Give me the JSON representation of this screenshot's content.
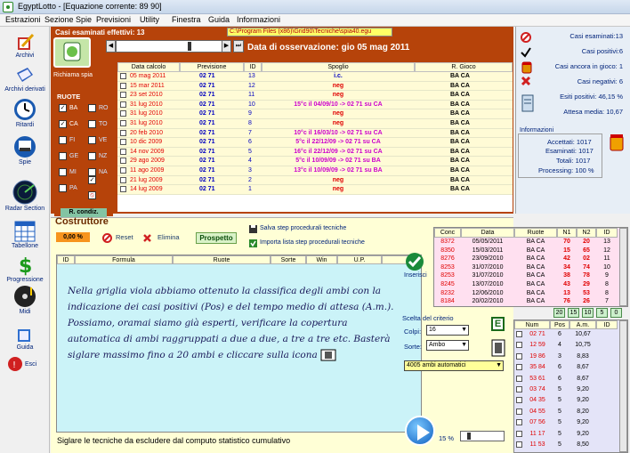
{
  "window": {
    "title": "EgyptLotto - [Equazione corrente: 89 90]"
  },
  "menu": [
    "Estrazioni",
    "Sezione Spie",
    "Previsioni",
    "Utility",
    "Finestra",
    "Guida",
    "Informazioni"
  ],
  "sidebar": [
    {
      "label": "Archivi",
      "icon": "book-pencil-icon"
    },
    {
      "label": "Archivi derivati",
      "icon": "book-icon"
    },
    {
      "label": "Ritardi",
      "icon": "clock-icon"
    },
    {
      "label": "Spie",
      "icon": "spy-icon"
    },
    {
      "label": "Radar Section",
      "icon": "radar-icon"
    },
    {
      "label": "Tabellone",
      "icon": "calendar-table-icon"
    },
    {
      "label": "Progressione",
      "icon": "dollar-icon"
    },
    {
      "label": "Midi",
      "icon": "music-icon"
    },
    {
      "label": "Guida",
      "icon": "guide-icon"
    },
    {
      "label": "Esci",
      "icon": "exit-icon"
    }
  ],
  "top": {
    "casi_label": "Casi esaminati effettivi: 13",
    "path": "C:\\Program Files (x86)\\Grid90\\Tecniche\\spia40.egu",
    "data_osservazione": "Data di osservazione:  gio 05 mag 2011",
    "richiama": "Richiama spia"
  },
  "grid1": {
    "headers": [
      "Data calcolo",
      "Previsione",
      "ID",
      "Spoglio",
      "R. Gioco"
    ],
    "rows": [
      {
        "date": "05 mag 2011",
        "prev": "02 71",
        "id": "13",
        "spoglio": "i.c.",
        "rg": "BA CA",
        "sclr": "#0000c0"
      },
      {
        "date": "15 mar 2011",
        "prev": "02 71",
        "id": "12",
        "spoglio": "neg",
        "rg": "BA CA",
        "sclr": "#e00000"
      },
      {
        "date": "23 set 2010",
        "prev": "02 71",
        "id": "11",
        "spoglio": "neg",
        "rg": "BA CA",
        "sclr": "#e00000"
      },
      {
        "date": "31 lug 2010",
        "prev": "02 71",
        "id": "10",
        "spoglio": "15°c il 04/09/10 -> 02 71 su CA",
        "rg": "BA CA",
        "sclr": "#cc00cc"
      },
      {
        "date": "31 lug 2010",
        "prev": "02 71",
        "id": "9",
        "spoglio": "neg",
        "rg": "BA CA",
        "sclr": "#e00000"
      },
      {
        "date": "31 lug 2010",
        "prev": "02 71",
        "id": "8",
        "spoglio": "neg",
        "rg": "BA CA",
        "sclr": "#e00000"
      },
      {
        "date": "20 feb 2010",
        "prev": "02 71",
        "id": "7",
        "spoglio": "10°c il 16/03/10 -> 02 71 su CA",
        "rg": "BA CA",
        "sclr": "#cc00cc"
      },
      {
        "date": "10 dic 2009",
        "prev": "02 71",
        "id": "6",
        "spoglio": "5°c il 22/12/09 -> 02 71 su CA",
        "rg": "BA CA",
        "sclr": "#cc00cc"
      },
      {
        "date": "14 nov 2009",
        "prev": "02 71",
        "id": "5",
        "spoglio": "16°c il 22/12/09 -> 02 71 su CA",
        "rg": "BA CA",
        "sclr": "#cc00cc"
      },
      {
        "date": "29 ago 2009",
        "prev": "02 71",
        "id": "4",
        "spoglio": "5°c il 10/09/09 -> 02 71 su BA",
        "rg": "BA CA",
        "sclr": "#cc00cc"
      },
      {
        "date": "11 ago 2009",
        "prev": "02 71",
        "id": "3",
        "spoglio": "13°c il 10/09/09 -> 02 71 su BA",
        "rg": "BA CA",
        "sclr": "#cc00cc"
      },
      {
        "date": "21 lug 2009",
        "prev": "02 71",
        "id": "2",
        "spoglio": "neg",
        "rg": "BA CA",
        "sclr": "#e00000"
      },
      {
        "date": "14 lug 2009",
        "prev": "02 71",
        "id": "1",
        "spoglio": "neg",
        "rg": "BA CA",
        "sclr": "#e00000"
      }
    ]
  },
  "ruote": {
    "title": "RUOTE",
    "items": [
      {
        "l": "BA",
        "c": true
      },
      {
        "l": "RO",
        "c": false
      },
      {
        "l": "CA",
        "c": true
      },
      {
        "l": "TO",
        "c": false
      },
      {
        "l": "FI",
        "c": false
      },
      {
        "l": "VE",
        "c": false
      },
      {
        "l": "GE",
        "c": false
      },
      {
        "l": "NZ",
        "c": false
      },
      {
        "l": "MI",
        "c": false
      },
      {
        "l": "NA",
        "c": false
      },
      {
        "l": "PA",
        "c": false
      }
    ],
    "cond": "R. condiz."
  },
  "right": {
    "casi_esaminati": "Casi esaminati:13",
    "casi_positivi": "Casi positivi:6",
    "casi_gioco": "Casi ancora in gioco: 1",
    "casi_negativi": "Casi negativi: 6",
    "esiti": "Esiti positivi: 46,15 %",
    "attesa": "Attesa media: 10,67",
    "info_title": "Informazioni",
    "accettati": "Accettati:  1017",
    "esaminati": "Esaminati:  1017",
    "totali": "Totali:  1017",
    "processing": "Processing:  100 %"
  },
  "costruttore": {
    "title": "Costruttore",
    "pct": "0,00 %",
    "reset": "Reset",
    "elimina": "Elimina",
    "prospetto": "Prospetto",
    "salva": "Salva step procedurali tecniche",
    "importa": "Importa lista step procedurali tecniche",
    "headers": [
      "ID",
      "Formula",
      "Ruote",
      "Sorte",
      "Win",
      "U.P."
    ],
    "note": "Nella griglia viola abbiamo ottenuto la classifica degli ambi con la indicazione dei casi positivi (Pos) e del tempo medio di attesa (A.m.). Possiamo, oramai siamo già esperti, verificare la copertura automatica di ambi raggruppati a due a due, a tre a tre etc. Basterà siglare massimo fino a 20 ambi e cliccare sulla icona",
    "footer": "Siglare le tecniche da escludere dal computo statistico cumulativo"
  },
  "conc": {
    "headers": [
      "Conc",
      "Data",
      "Ruote",
      "N1",
      "N2",
      "ID"
    ],
    "rows": [
      [
        "8372",
        "05/05/2011",
        "BA CA",
        "70",
        "20",
        "13"
      ],
      [
        "8350",
        "15/03/2011",
        "BA CA",
        "15",
        "65",
        "12"
      ],
      [
        "8276",
        "23/09/2010",
        "BA CA",
        "42",
        "02",
        "11"
      ],
      [
        "8253",
        "31/07/2010",
        "BA CA",
        "34",
        "74",
        "10"
      ],
      [
        "8253",
        "31/07/2010",
        "BA CA",
        "38",
        "78",
        "9"
      ],
      [
        "8245",
        "13/07/2010",
        "BA CA",
        "43",
        "29",
        "8"
      ],
      [
        "8232",
        "12/06/2010",
        "BA CA",
        "13",
        "53",
        "8"
      ],
      [
        "8184",
        "20/02/2010",
        "BA CA",
        "76",
        "26",
        "7"
      ]
    ],
    "counters": [
      "20",
      "15",
      "10",
      "5",
      "0"
    ],
    "inserisci": "Inserisci"
  },
  "criterio": {
    "title": "Scelta del criterio",
    "colpi_label": "Colpi:",
    "colpi": "16",
    "sorte_label": "Sorte:",
    "sorte": "Ambo",
    "ambi": "4005 ambi automatici",
    "pct": "15 %"
  },
  "numgrid": {
    "headers": [
      "Num",
      "Pos",
      "A.m.",
      "ID"
    ],
    "rows": [
      [
        "02 71",
        "6",
        "10,67"
      ],
      [
        "12 59",
        "4",
        "10,75"
      ],
      [
        "19 86",
        "3",
        "8,83"
      ],
      [
        "35 84",
        "6",
        "8,67"
      ],
      [
        "53 61",
        "6",
        "8,67"
      ],
      [
        "03 74",
        "5",
        "9,20"
      ],
      [
        "04 35",
        "5",
        "9,20"
      ],
      [
        "04 55",
        "5",
        "8,20"
      ],
      [
        "07 56",
        "5",
        "9,20"
      ],
      [
        "11 17",
        "5",
        "9,20"
      ],
      [
        "11 53",
        "5",
        "8,50"
      ]
    ]
  }
}
